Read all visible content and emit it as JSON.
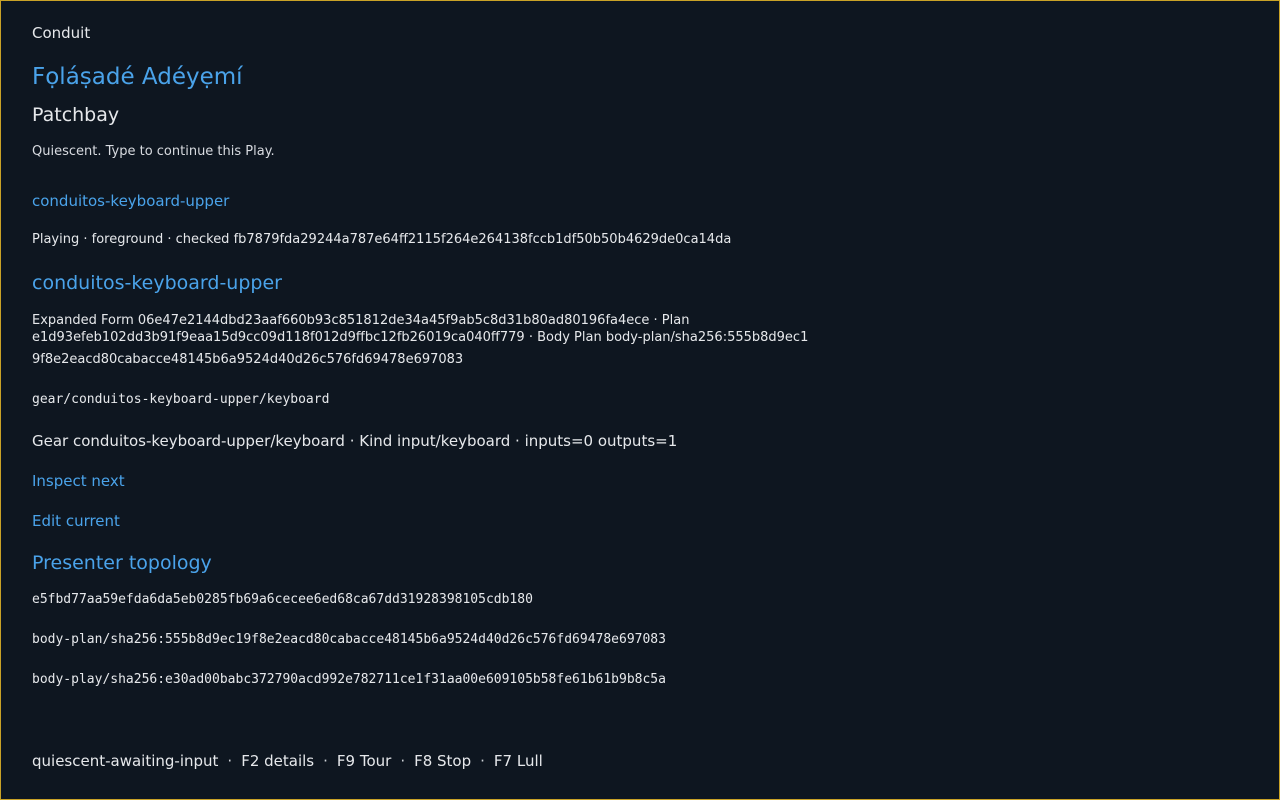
{
  "app": {
    "name": "Conduit"
  },
  "user": {
    "name": "Fọláṣadé Adéyẹmí"
  },
  "page": {
    "title": "Patchbay",
    "status_message": "Quiescent. Type to continue this Play."
  },
  "play": {
    "link_label": "conduitos-keyboard-upper",
    "status_line": "Playing · foreground · checked fb7879fda29244a787e64ff2115f264e264138fccb1df50b50b4629de0ca14da"
  },
  "form_section": {
    "title": "conduitos-keyboard-upper",
    "expanded_text": "Expanded Form 06e47e2144dbd23aaf660b93c851812de34a45f9ab5c8d31b80ad80196fa4ece · Plan e1d93efeb102dd3b91f9eaa15d9cc09d118f012d9ffbc12fb26019ca040ff779 · Body Plan body-plan/sha256:555b8d9ec1",
    "expanded_text_cont": "9f8e2eacd80cabacce48145b6a9524d40d26c576fd69478e697083",
    "gear_path": "gear/conduitos-keyboard-upper/keyboard",
    "gear_description": "Gear conduitos-keyboard-upper/keyboard · Kind input/keyboard · inputs=0 outputs=1"
  },
  "actions": {
    "inspect_next": "Inspect next",
    "edit_current": "Edit current"
  },
  "topology": {
    "title": "Presenter topology",
    "hashes": [
      "e5fbd77aa59efda6da5eb0285fb69a6cecee6ed68ca67dd31928398105cdb180",
      "body-plan/sha256:555b8d9ec19f8e2eacd80cabacce48145b6a9524d40d26c576fd69478e697083",
      "body-play/sha256:e30ad00babc372790acd992e782711ce1f31aa00e609105b58fe61b61b9b8c5a"
    ]
  },
  "footer": {
    "state": "quiescent-awaiting-input",
    "separator": "·",
    "keys": [
      "F2 details",
      "F9 Tour",
      "F8 Stop",
      "F7 Lull"
    ]
  },
  "colors": {
    "background": "#0e1620",
    "accent": "#4aa3ea",
    "text": "#e6e8eb",
    "frame_border": "#c9a227"
  }
}
